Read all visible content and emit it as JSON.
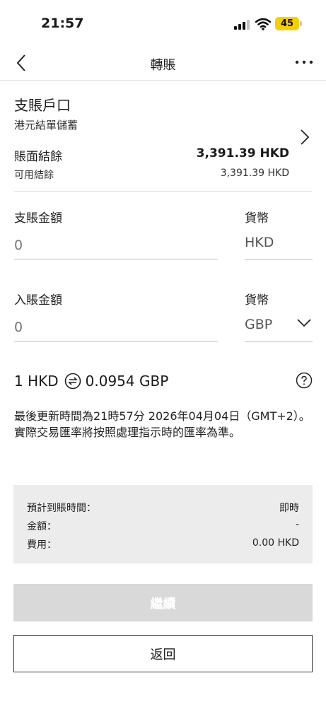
{
  "status_bar": {
    "time": "21:57",
    "battery_level": "45",
    "icons": [
      "signal-icon",
      "wifi-icon",
      "battery-icon"
    ]
  },
  "nav": {
    "title": "轉賬",
    "back_icon": "back-chevron-icon",
    "more_icon": "more-dots-icon"
  },
  "account": {
    "title": "支賬戶口",
    "type": "港元結單儲蓄",
    "balance_label": "賬面結餘",
    "balance_value": "3,391.39 HKD",
    "available_label": "可用結餘",
    "available_value": "3,391.39 HKD"
  },
  "debit": {
    "label": "支賬金額",
    "placeholder": "0",
    "currency_label": "貨幣",
    "currency": "HKD"
  },
  "credit": {
    "label": "入賬金額",
    "placeholder": "0",
    "currency_label": "貨幣",
    "currency": "GBP"
  },
  "rate": {
    "from": "1 HKD",
    "to": "0.0954 GBP"
  },
  "notice": "最後更新時間為21時57分 2026年04月04日（GMT+2）。實際交易匯率將按照處理指示時的匯率為準。",
  "summary": {
    "rows": [
      {
        "label": "預計到賬時間：",
        "value": "即時"
      },
      {
        "label": "金額：",
        "value": "-"
      },
      {
        "label": "費用：",
        "value": "0.00 HKD"
      }
    ]
  },
  "buttons": {
    "continue": "繼續",
    "back": "返回"
  },
  "colors": {
    "battery": "#f5d000",
    "summary_bg": "#ececec",
    "disabled_button": "#d9d9d9"
  }
}
